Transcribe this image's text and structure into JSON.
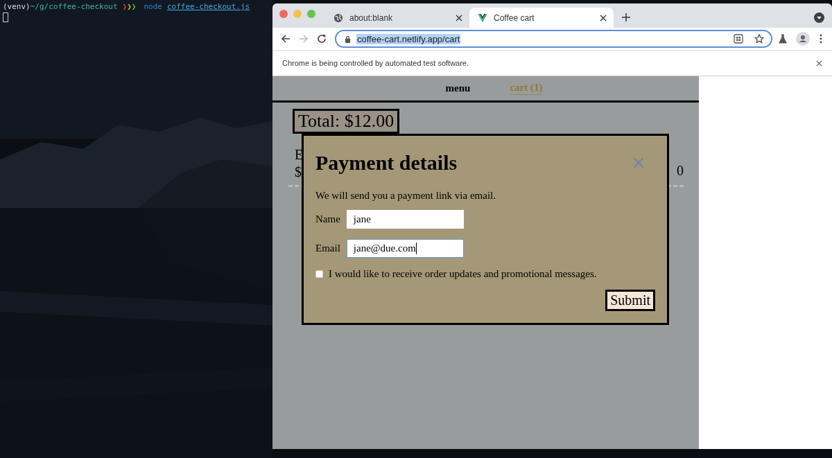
{
  "terminal": {
    "venv": "(venv)",
    "path": "~/g/coffee-checkout",
    "chevrons": [
      {
        "text": "❯",
        "color": "#d9442f"
      },
      {
        "text": "❯",
        "color": "#d9b82f"
      },
      {
        "text": "❯",
        "color": "#52c23a"
      }
    ],
    "command": "node",
    "argument": "coffee-checkout.js"
  },
  "browser": {
    "tabs": [
      {
        "title": "about:blank",
        "kind": "blank",
        "selected": false
      },
      {
        "title": "Coffee cart",
        "kind": "site",
        "selected": true
      }
    ],
    "address": "coffee-cart.netlify.app/cart",
    "address_selected": true,
    "infobar": "Chrome is being controlled by automated test software."
  },
  "page": {
    "nav": [
      {
        "label": "menu",
        "selected": false
      },
      {
        "label": "cart (1)",
        "selected": true
      }
    ],
    "total": "Total: $12.00",
    "cart_item": {
      "name": "E",
      "price": "$",
      "total": "0"
    },
    "modal": {
      "title": "Payment details",
      "close": "×",
      "message": "We will send you a payment link via email.",
      "fields": [
        {
          "label": "Name",
          "value": "jane",
          "focused": false
        },
        {
          "label": "Email",
          "value": "jane@due.com",
          "focused": true
        }
      ],
      "consent": {
        "label": "I would like to receive order updates and promotional messages.",
        "checked": false
      },
      "submit": "Submit"
    }
  }
}
